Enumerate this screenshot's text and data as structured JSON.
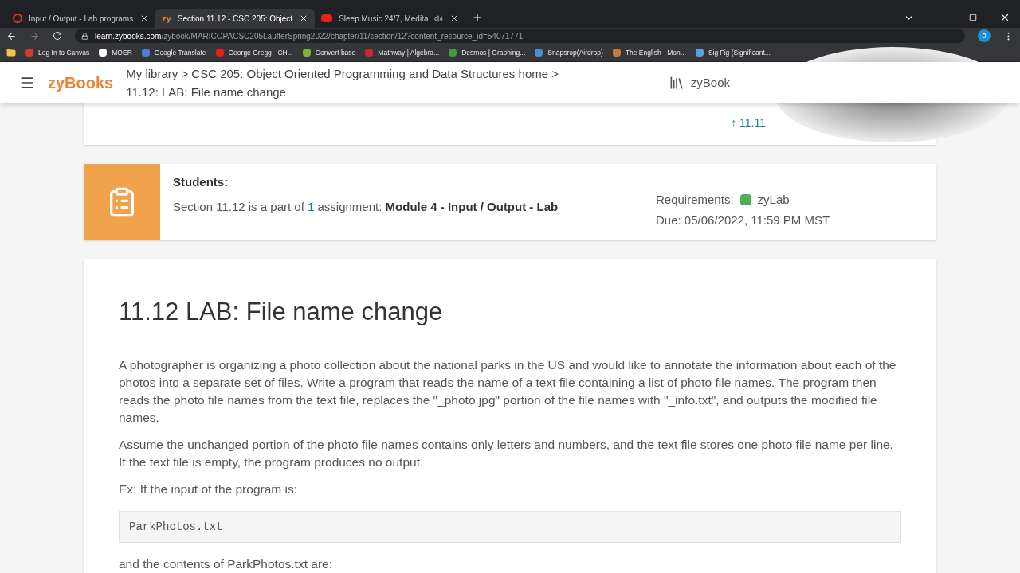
{
  "browser": {
    "tabs": [
      {
        "title": "Input / Output - Lab programs",
        "selected": false,
        "kind": "circle"
      },
      {
        "title": "Section 11.12 - CSC 205: Object",
        "selected": true,
        "kind": "zy",
        "favicon_text": "zy"
      },
      {
        "title": "Sleep Music 24/7, Medita",
        "selected": false,
        "kind": "video"
      }
    ],
    "url_host": "learn.zybooks.com",
    "url_path": "/zybook/MARICOPACSC205LaufferSpring2022/chapter/11/section/12?content_resource_id=54071771",
    "profile_badge": "0",
    "bookmarks": [
      {
        "label": "Log In to Canvas",
        "color": "#d33b2f"
      },
      {
        "label": "MOER",
        "color": "#ffffff"
      },
      {
        "label": "Google Translate",
        "color": "#4a7fd6"
      },
      {
        "label": "George Gregg - CH...",
        "color": "#e62117"
      },
      {
        "label": "Convert base",
        "color": "#7fb03a"
      },
      {
        "label": "Mathway | Algebra...",
        "color": "#c8243a"
      },
      {
        "label": "Desmos | Graphing...",
        "color": "#3f9a3a"
      },
      {
        "label": "Snapsrop(Airdrop)",
        "color": "#4a90c8"
      },
      {
        "label": "The English - Mon...",
        "color": "#c87a3a"
      },
      {
        "label": "Sig Fig (Significant...",
        "color": "#5aa0d8"
      }
    ]
  },
  "header": {
    "logo": "zyBooks",
    "breadcrumb_1": "My library > CSC 205: Object Oriented Programming and Data Structures home >",
    "breadcrumb_2": "11.12: LAB: File name change",
    "library_label": "zyBook"
  },
  "prev_link": "11.11",
  "up_arrow": "↑",
  "assignment": {
    "heading": "Students:",
    "text_before": "Section 11.12 is a part of ",
    "count": "1",
    "text_mid": " assignment: ",
    "name": "Module 4 - Input / Output - Lab",
    "requirements_label": "Requirements:",
    "requirement": "zyLab",
    "due": "Due: 05/06/2022, 11:59 PM MST"
  },
  "content": {
    "title": "11.12 LAB: File name change",
    "paragraphs": [
      "A photographer is organizing a photo collection about the national parks in the US and would like to annotate the information about each of the photos into a separate set of files. Write a program that reads the name of a text file containing a list of photo file names. The program then reads the photo file names from the text file, replaces the \"_photo.jpg\" portion of the file names with \"_info.txt\", and outputs the modified file names.",
      "Assume the unchanged portion of the photo file names contains only letters and numbers, and the text file stores one photo file name per line. If the text file is empty, the program produces no output.",
      "Ex: If the input of the program is:"
    ],
    "code": "ParkPhotos.txt",
    "after": "and the contents of ParkPhotos.txt are:"
  }
}
